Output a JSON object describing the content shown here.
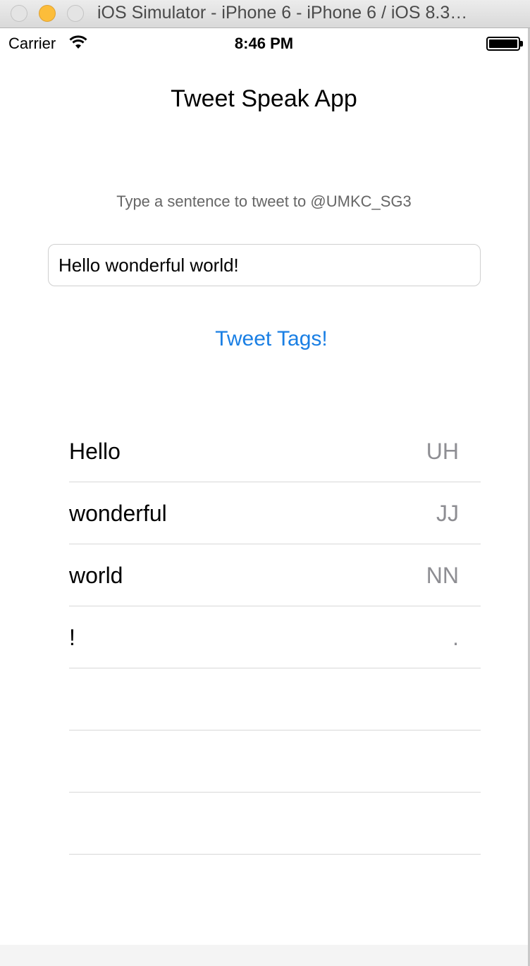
{
  "window": {
    "title": "iOS Simulator - iPhone 6 - iPhone 6 / iOS 8.3…"
  },
  "status_bar": {
    "carrier": "Carrier",
    "time": "8:46 PM",
    "battery_level": 1.0
  },
  "app": {
    "title": "Tweet Speak App",
    "prompt": "Type a sentence to tweet to @UMKC_SG3",
    "input_value": "Hello wonderful world!",
    "button_label": "Tweet Tags!"
  },
  "tags": [
    {
      "word": "Hello",
      "pos": "UH"
    },
    {
      "word": "wonderful",
      "pos": "JJ"
    },
    {
      "word": "world",
      "pos": "NN"
    },
    {
      "word": "!",
      "pos": "."
    },
    {
      "word": "",
      "pos": ""
    },
    {
      "word": "",
      "pos": ""
    },
    {
      "word": "",
      "pos": ""
    }
  ],
  "colors": {
    "accent": "#1a7fe4",
    "tag_secondary": "#8e8e93",
    "prompt_text": "#666666"
  }
}
